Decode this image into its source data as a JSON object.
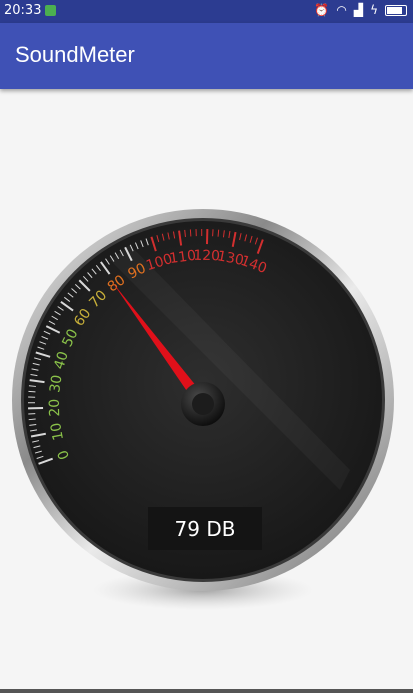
{
  "status_bar": {
    "time": "20:33",
    "notification_icon": "android-notification-icon",
    "icons": [
      "alarm-icon",
      "wifi-icon",
      "signal-icon",
      "charging-icon",
      "battery-icon"
    ]
  },
  "app_bar": {
    "title": "SoundMeter",
    "color": "#3f51b5"
  },
  "gauge": {
    "value": 79,
    "readout": "79 DB",
    "min": 0,
    "max": 140,
    "tick_labels": [
      "0",
      "10",
      "20",
      "30",
      "40",
      "50",
      "60",
      "70",
      "80",
      "90",
      "100",
      "110",
      "120",
      "130",
      "140"
    ],
    "label_colors": {
      "low": "#8bc34a",
      "mid": "#c8b03a",
      "high_orange": "#e07020",
      "high_red": "#d32f2f"
    },
    "needle_color": "#e0101a"
  }
}
